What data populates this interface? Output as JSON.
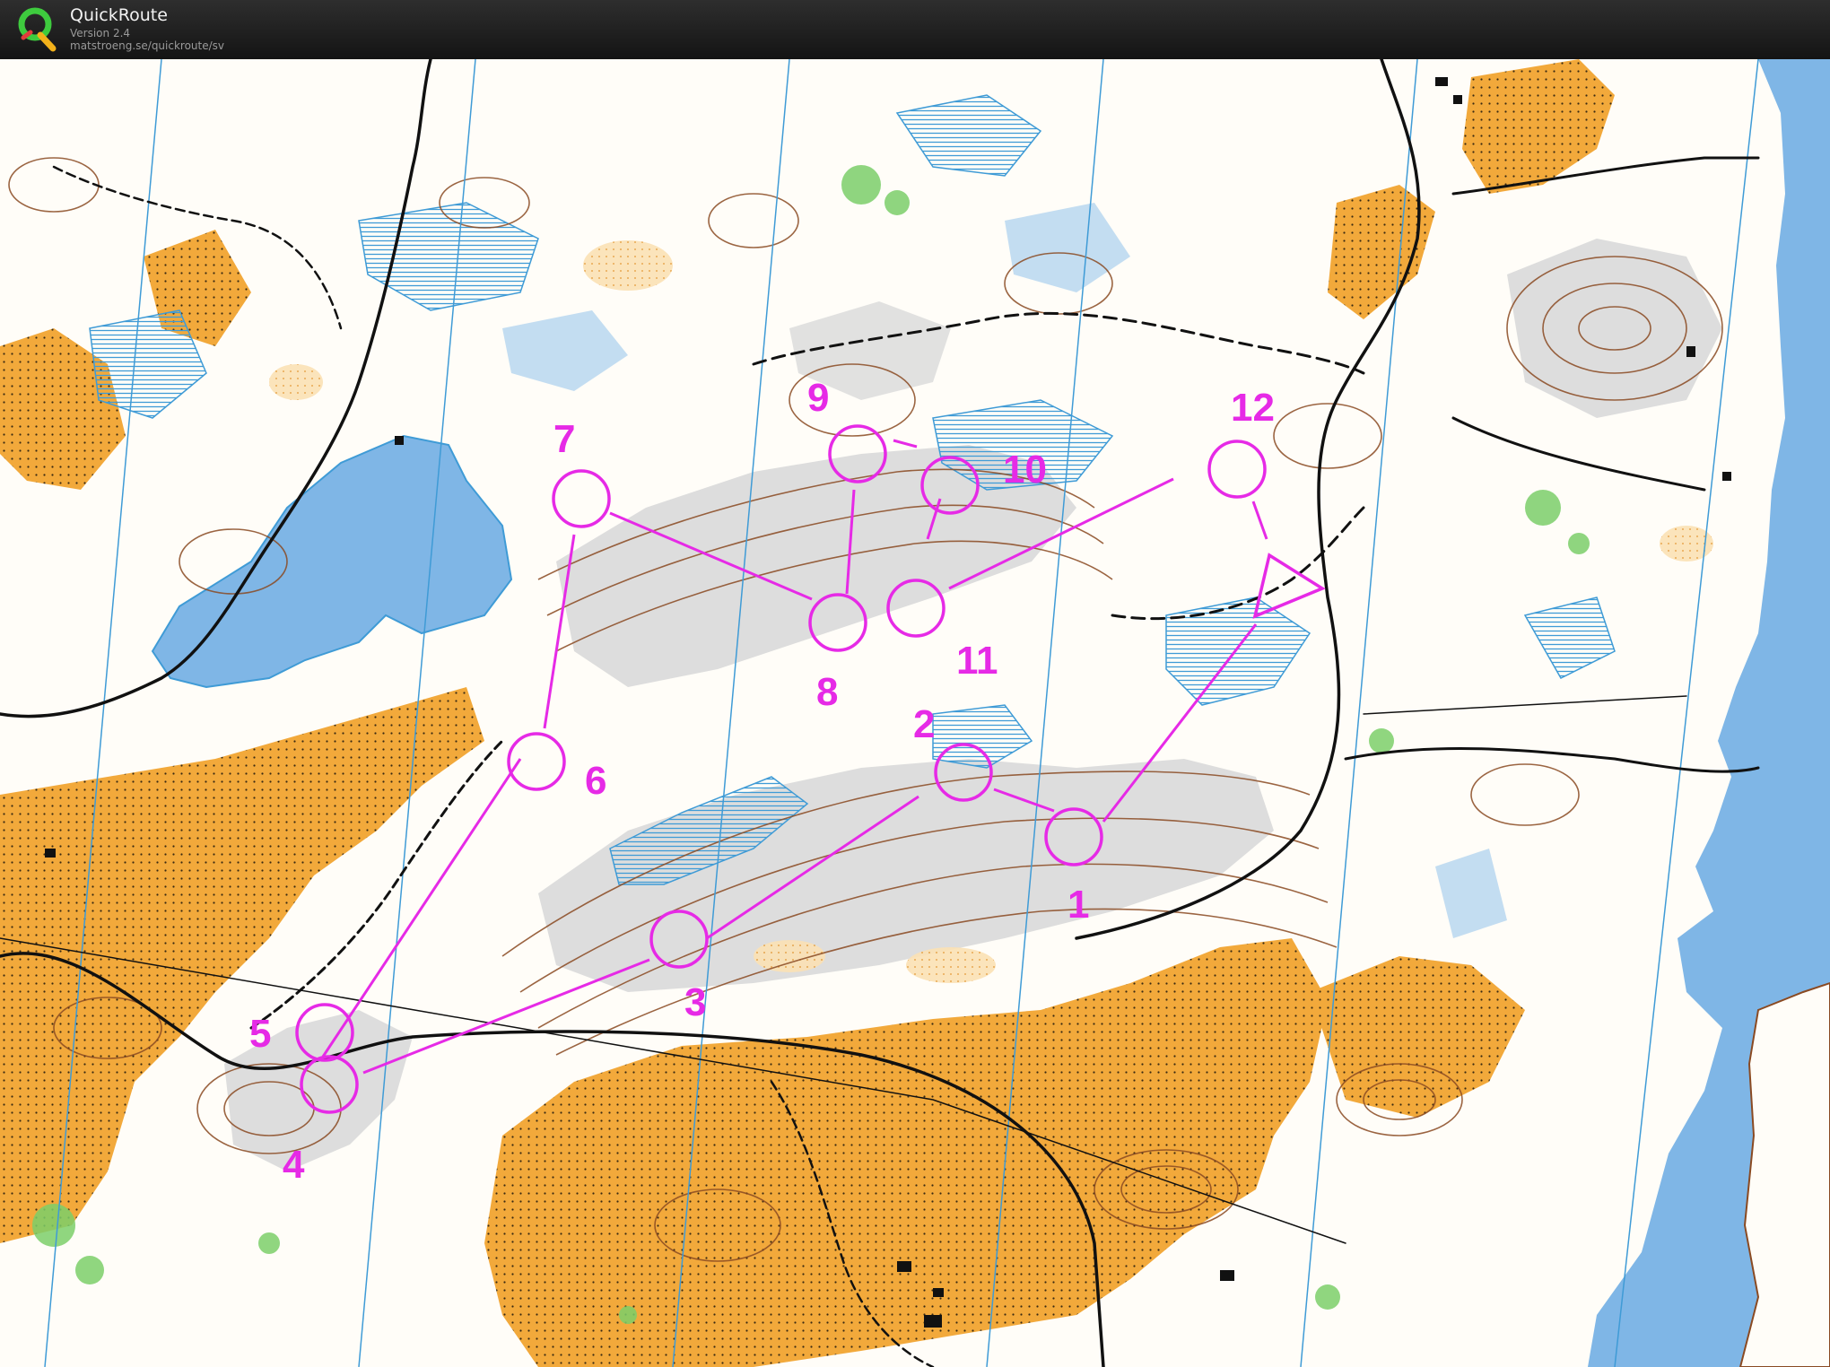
{
  "app": {
    "title": "QuickRoute",
    "version": "Version 2.4",
    "url": "matstroeng.se/quickroute/sv",
    "logo_icon": "quickroute-q-logo-icon"
  },
  "course": {
    "color": "#e62ae6",
    "start_symbol": "start-triangle-icon",
    "controls": [
      {
        "label": "1"
      },
      {
        "label": "2"
      },
      {
        "label": "3"
      },
      {
        "label": "4"
      },
      {
        "label": "5"
      },
      {
        "label": "6"
      },
      {
        "label": "7"
      },
      {
        "label": "8"
      },
      {
        "label": "9"
      },
      {
        "label": "10"
      },
      {
        "label": "11"
      },
      {
        "label": "12"
      }
    ]
  },
  "map_colors": {
    "open_land": "#f2a93b",
    "rock_area": "#d9d9d9",
    "water": "#7fb6e6",
    "marsh": "#3f9bd6",
    "contour": "#8a4a22",
    "vegetation_green": "#7ccf6a",
    "track": "#111111",
    "white_forest": "#fffdf8"
  }
}
